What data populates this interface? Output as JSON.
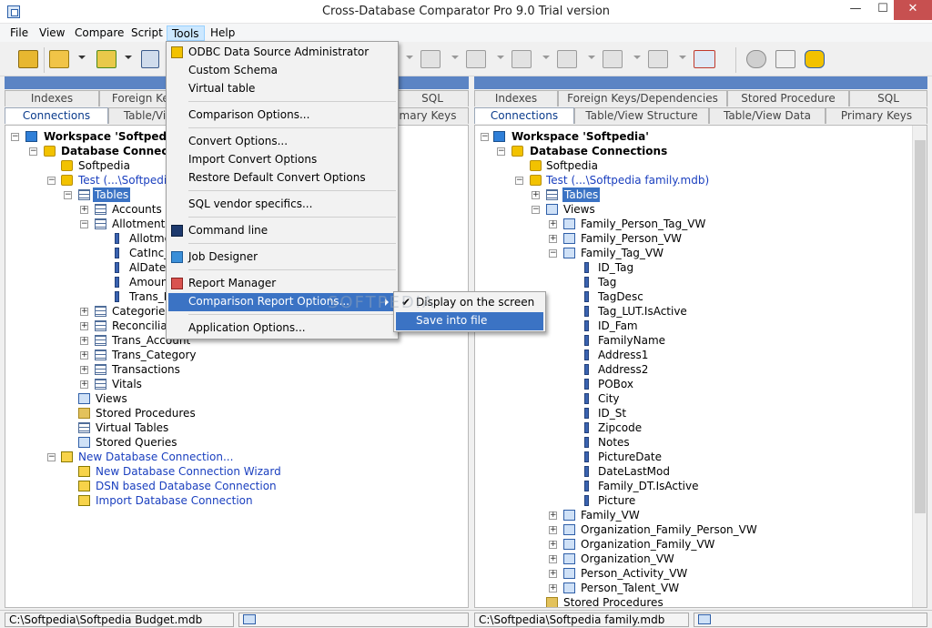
{
  "window": {
    "title": "Cross-Database Comparator Pro 9.0 Trial version",
    "close_glyph": "✕",
    "minimize_glyph": "—",
    "maximize_glyph": "☐"
  },
  "menubar": [
    "File",
    "View",
    "Compare",
    "Script",
    "Tools",
    "Help"
  ],
  "tools_menu": {
    "items": [
      {
        "label": "ODBC Data Source Administrator",
        "icon": "database-icon"
      },
      {
        "label": "Custom Schema",
        "icon": ""
      },
      {
        "label": "Virtual table",
        "icon": ""
      },
      {
        "label": "Comparison Options...",
        "icon": ""
      },
      {
        "label": "Convert Options...",
        "icon": ""
      },
      {
        "label": "Import Convert Options",
        "icon": ""
      },
      {
        "label": "Restore Default Convert Options",
        "icon": ""
      },
      {
        "label": "SQL vendor specifics...",
        "icon": ""
      },
      {
        "label": "Command line",
        "icon": "terminal-icon"
      },
      {
        "label": "Job Designer",
        "icon": "job-icon"
      },
      {
        "label": "Report Manager",
        "icon": "report-icon"
      },
      {
        "label": "Comparison Report Options...",
        "icon": ""
      },
      {
        "label": "Application Options...",
        "icon": ""
      }
    ],
    "submenu": [
      {
        "label": "Display on the screen",
        "check": "✔"
      },
      {
        "label": "Save into file",
        "check": ""
      }
    ]
  },
  "left_pane": {
    "tabs_top": [
      "Indexes",
      "Foreign Keys",
      "SQL"
    ],
    "tabs_bottom": [
      "Connections",
      "Table/Vi",
      "mary Keys"
    ],
    "tree": [
      {
        "label": "Workspace 'Softpedia'"
      },
      {
        "label": "Database Connection"
      },
      {
        "label": "Softpedia"
      },
      {
        "label": "Test  (...\\Softpedia B"
      },
      {
        "label": "Tables"
      },
      {
        "label": "Accounts"
      },
      {
        "label": "Allotments"
      },
      {
        "label": "Allotmen"
      },
      {
        "label": "CatInc_I"
      },
      {
        "label": "AlDate"
      },
      {
        "label": "Amount"
      },
      {
        "label": "Trans_ID"
      },
      {
        "label": "Categories"
      },
      {
        "label": "Reconciliatio"
      },
      {
        "label": "Trans_Account"
      },
      {
        "label": "Trans_Category"
      },
      {
        "label": "Transactions"
      },
      {
        "label": "Vitals"
      },
      {
        "label": "Views"
      },
      {
        "label": "Stored Procedures"
      },
      {
        "label": "Virtual Tables"
      },
      {
        "label": "Stored Queries"
      },
      {
        "label": "New Database Connection..."
      },
      {
        "label": "New Database Connection Wizard"
      },
      {
        "label": "DSN based Database Connection"
      },
      {
        "label": "Import Database Connection"
      }
    ],
    "status": "C:\\Softpedia\\Softpedia Budget.mdb"
  },
  "right_pane": {
    "tabs_top": [
      "Indexes",
      "Foreign Keys/Dependencies",
      "Stored Procedure",
      "SQL"
    ],
    "tabs_bottom": [
      "Connections",
      "Table/View Structure",
      "Table/View Data",
      "Primary Keys"
    ],
    "tree": [
      {
        "label": "Workspace 'Softpedia'"
      },
      {
        "label": "Database Connections"
      },
      {
        "label": "Softpedia"
      },
      {
        "label": "Test  (...\\Softpedia family.mdb)"
      },
      {
        "label": "Tables"
      },
      {
        "label": "Views"
      },
      {
        "label": "Family_Person_Tag_VW"
      },
      {
        "label": "Family_Person_VW"
      },
      {
        "label": "Family_Tag_VW"
      },
      {
        "label": "ID_Tag"
      },
      {
        "label": "Tag"
      },
      {
        "label": "TagDesc"
      },
      {
        "label": "Tag_LUT.IsActive"
      },
      {
        "label": "ID_Fam"
      },
      {
        "label": "FamilyName"
      },
      {
        "label": "Address1"
      },
      {
        "label": "Address2"
      },
      {
        "label": "POBox"
      },
      {
        "label": "City"
      },
      {
        "label": "ID_St"
      },
      {
        "label": "Zipcode"
      },
      {
        "label": "Notes"
      },
      {
        "label": "PictureDate"
      },
      {
        "label": "DateLastMod"
      },
      {
        "label": "Family_DT.IsActive"
      },
      {
        "label": "Picture"
      },
      {
        "label": "Family_VW"
      },
      {
        "label": "Organization_Family_Person_VW"
      },
      {
        "label": "Organization_Family_VW"
      },
      {
        "label": "Organization_VW"
      },
      {
        "label": "Person_Activity_VW"
      },
      {
        "label": "Person_Talent_VW"
      },
      {
        "label": "Stored Procedures"
      }
    ],
    "status": "C:\\Softpedia\\Softpedia family.mdb"
  },
  "watermark": "SOFTPEDIA"
}
